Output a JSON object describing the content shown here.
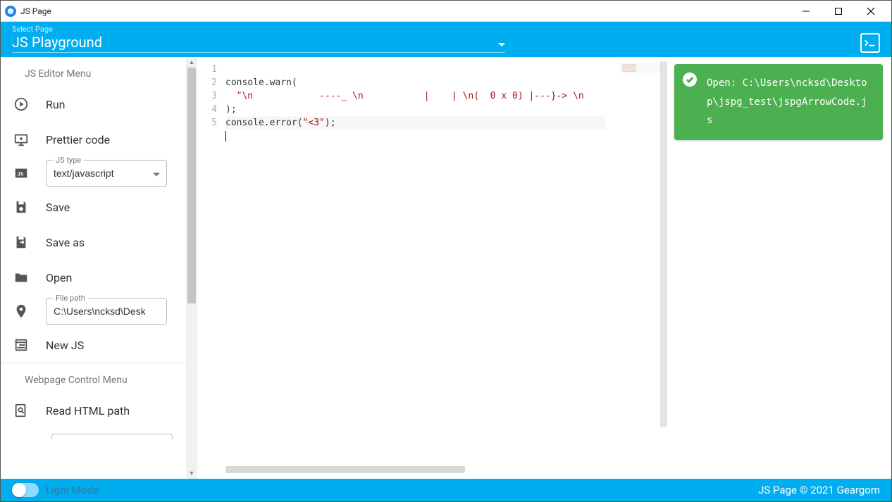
{
  "window": {
    "title": "JS Page"
  },
  "appbar": {
    "select_label": "Select Page",
    "page_title": "JS Playground"
  },
  "sidebar": {
    "section1_title": "JS Editor Menu",
    "section2_title": "Webpage Control Menu",
    "run": "Run",
    "prettier": "Prettier code",
    "jstype_label": "JS type",
    "jstype_value": "text/javascript",
    "save": "Save",
    "saveas": "Save as",
    "open": "Open",
    "filepath_label": "File path",
    "filepath_value": "C:\\Users\\ncksd\\Desktop\\jspg_test\\jspgArrowCode.js",
    "newjs": "New JS",
    "readhtml": "Read HTML path"
  },
  "editor": {
    "lines": [
      "1",
      "2",
      "3",
      "4",
      "5"
    ],
    "code_plain_1a": "console.warn(",
    "code_str_2": "  \"\\n            ----_ \\n           |    | \\n(  0 x 0) |---}-> \\n",
    "code_plain_3": ");",
    "code_plain_4a": "console.error(",
    "code_str_4b": "\"<3\"",
    "code_plain_4c": ");"
  },
  "toast": {
    "message": "Open: C:\\Users\\ncksd\\Desktop\\jspg_test\\jspgArrowCode.js"
  },
  "footer": {
    "mode": "Light Mode",
    "copyright": "JS Page © 2021 Geargom"
  }
}
